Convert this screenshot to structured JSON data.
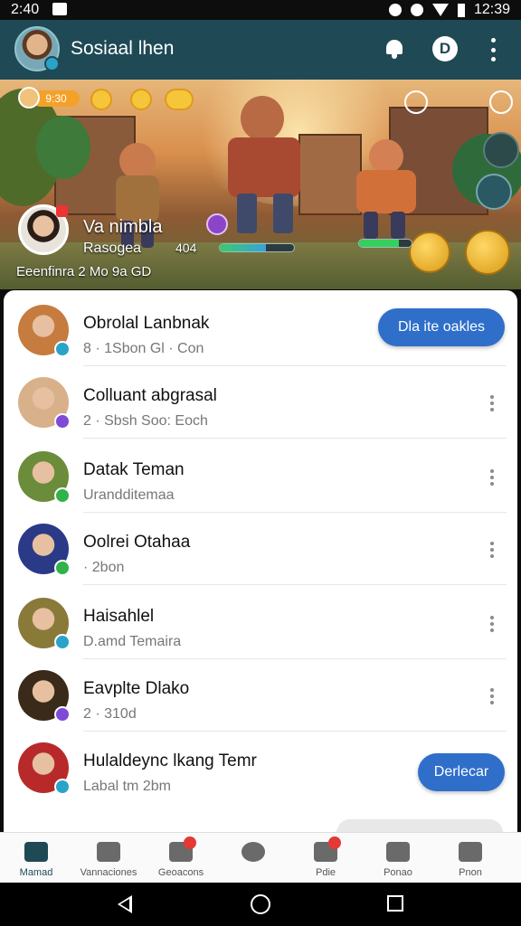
{
  "status_bar": {
    "time": "2:40",
    "clock": "12:39"
  },
  "app_bar": {
    "title": "Sosiaal lhen",
    "profile_letter": "D"
  },
  "game": {
    "hud_score": "9:30",
    "player_name": "Va nimbla",
    "player_status": "Rasogea",
    "player_level": "404",
    "player_footer": "Eeenfinra  2 Mo 9a GD",
    "xp_progress": 0.62,
    "hp_progress": 0.75
  },
  "friends": [
    {
      "name": "Obrolal Lanbnak",
      "sub": "8 · 1Sbon Gl · Con",
      "action": "button",
      "button_label": "Dla ite oakles",
      "avatar_color": "#c67b3f",
      "badge_color": "#2aa3c9"
    },
    {
      "name": "Colluant abgrasal",
      "sub": "2 · Sbsh Soo: Eoch",
      "action": "more",
      "avatar_color": "#d8b08a",
      "badge_color": "#7e4ad6"
    },
    {
      "name": "Datak Teman",
      "sub": "Urandditemaa",
      "action": "more",
      "avatar_color": "#6b8c3a",
      "badge_color": "#31b24a"
    },
    {
      "name": "Oolrei Otahaa",
      "sub": "· 2bon",
      "action": "more",
      "avatar_color": "#2b3a86",
      "badge_color": "#31b24a"
    },
    {
      "name": "Haisahlel",
      "sub": "D.amd Temaira",
      "action": "more",
      "avatar_color": "#8a7a3a",
      "badge_color": "#2aa3c9"
    },
    {
      "name": "Eavplte Dlako",
      "sub": "2 · 310d",
      "action": "more",
      "avatar_color": "#3a2a1a",
      "badge_color": "#7e4ad6"
    },
    {
      "name": "Hulaldeync lkang Temr",
      "sub": "Labal tm 2bm",
      "action": "button",
      "button_label": "Derlecar",
      "avatar_color": "#b82a2a",
      "badge_color": "#2aa3c9"
    }
  ],
  "bottom_nav": [
    {
      "label": "Mamad",
      "icon": "home-icon",
      "active": true,
      "dot": false
    },
    {
      "label": "Vannaciones",
      "icon": "face-icon",
      "active": false,
      "dot": false
    },
    {
      "label": "Geoacons",
      "icon": "chest-icon",
      "active": false,
      "dot": true
    },
    {
      "label": "",
      "icon": "record-icon",
      "active": false,
      "dot": false
    },
    {
      "label": "Pdie",
      "icon": "gift-icon",
      "active": false,
      "dot": true
    },
    {
      "label": "Ponao",
      "icon": "camera-icon",
      "active": false,
      "dot": false
    },
    {
      "label": "Pnon",
      "icon": "person-icon",
      "active": false,
      "dot": false
    }
  ]
}
